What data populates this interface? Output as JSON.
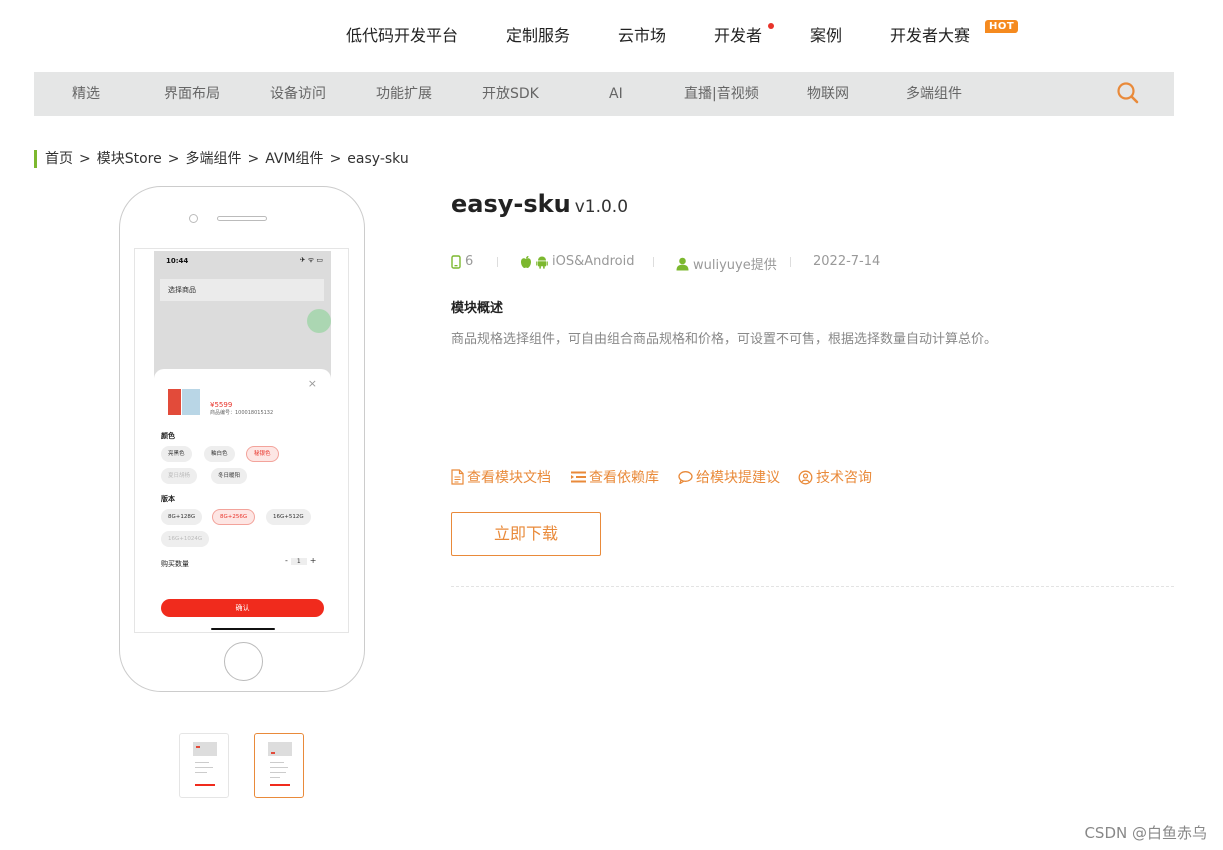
{
  "topnav": {
    "items": [
      "低代码开发平台",
      "定制服务",
      "云市场",
      "开发者",
      "案例",
      "开发者大赛"
    ],
    "hot_badge": "HOT"
  },
  "subnav": {
    "items": [
      "精选",
      "界面布局",
      "设备访问",
      "功能扩展",
      "开放SDK",
      "AI",
      "直播|音视频",
      "物联网",
      "多端组件"
    ]
  },
  "breadcrumb": [
    "首页",
    "模块Store",
    "多端组件",
    "AVM组件",
    "easy-sku"
  ],
  "breadcrumb_sep": ">",
  "module": {
    "name": "easy-sku",
    "version": "v1.0.0",
    "count": "6",
    "platform": "iOS&Android",
    "author": "wuliyuye提供",
    "date": "2022-7-14",
    "overview_title": "模块概述",
    "description": "商品规格选择组件，可自由组合商品规格和价格，可设置不可售，根据选择数量自动计算总价。"
  },
  "links": {
    "docs": "查看模块文档",
    "deps": "查看依赖库",
    "suggest": "给模块提建议",
    "support": "技术咨询"
  },
  "download_label": "立即下载",
  "preview": {
    "time": "10:44",
    "status_icons": "✈ ᯤ ▭",
    "select_title": "选择商品",
    "close": "×",
    "price": "¥5599",
    "product_code": "商品编号：100018015132",
    "color_label": "颜色",
    "colors": [
      "亮黑色",
      "釉白色",
      "秘银色",
      "夏日胡杨",
      "冬日暖阳"
    ],
    "version_label": "版本",
    "versions": [
      "8G+128G",
      "8G+256G",
      "16G+512G",
      "16G+1024G"
    ],
    "qty_label": "购买数量",
    "qty_minus": "-",
    "qty_value": "1",
    "qty_plus": "+",
    "confirm": "确认"
  },
  "watermark": "CSDN @白鱼赤乌",
  "colors": {
    "accent": "#e98a3a",
    "green": "#7cb82f",
    "hot": "#f58a1f",
    "red": "#f02b1d"
  }
}
